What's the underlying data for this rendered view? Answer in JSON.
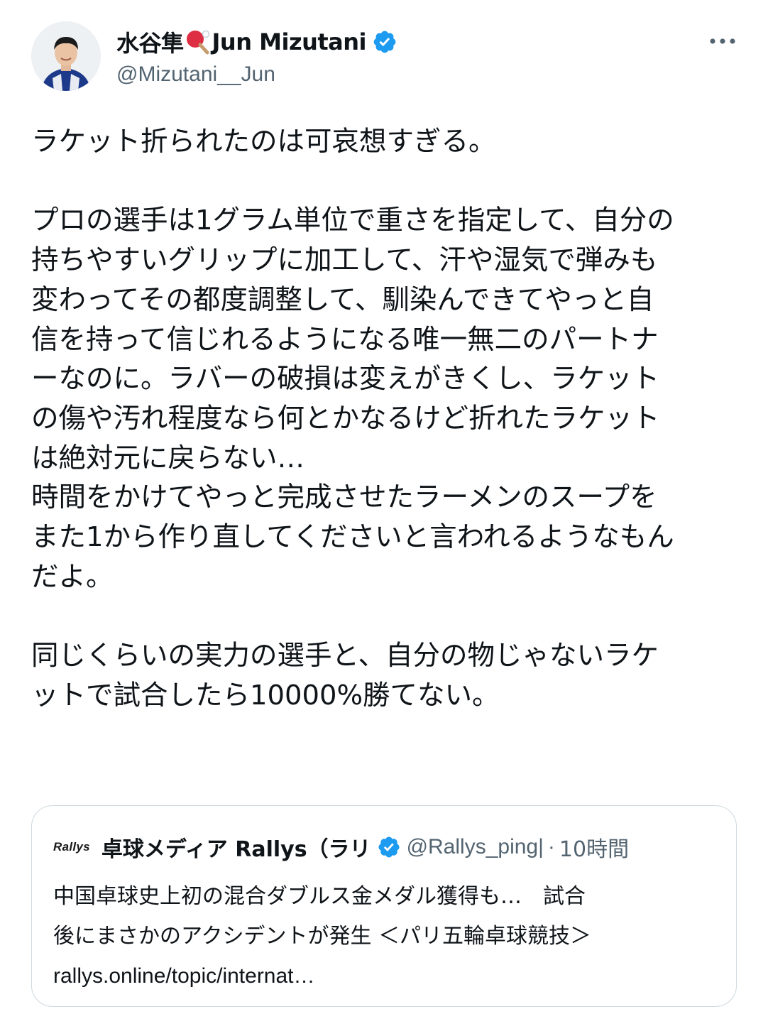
{
  "author": {
    "display_name": "水谷隼",
    "display_name_en": "Jun Mizutani",
    "handle": "@Mizutani__Jun",
    "verified": true,
    "paddle_icon": "ping-pong-paddle-emoji"
  },
  "tweet": {
    "text": "ラケット折られたのは可哀想すぎる。\n\nプロの選手は1グラム単位で重さを指定して、自分の\n持ちやすいグリップに加工して、汗や湿気で弾みも\n変わってその都度調整して、馴染んできてやっと自\n信を持って信じれるようになる唯一無二のパートナ\nーなのに。ラバーの破損は変えがきくし、ラケット\nの傷や汚れ程度なら何とかなるけど折れたラケット\nは絶対元に戻らない…\n時間をかけてやっと完成させたラーメンのスープを\nまた1から作り直してくださいと言われるようなもん\nだよ。\n\n同じくらいの実力の選手と、自分の物じゃないラケ\nットで試合したら10000%勝てない。"
  },
  "quote": {
    "logo_text": "Rallys",
    "name": "卓球メディア Rallys（ラリ",
    "handle": "@Rallys_ping|",
    "separator": "·",
    "time": "10時間",
    "line1": "中国卓球史上初の混合ダブルス金メダル獲得も…　試合",
    "line2": "後にまさかのアクシデントが発生 ＜パリ五輪卓球競技＞",
    "link": "rallys.online/topic/internat…"
  },
  "colors": {
    "text": "#0f1419",
    "secondary": "#536471",
    "verified": "#1d9bf0",
    "border": "#cfd9de"
  }
}
